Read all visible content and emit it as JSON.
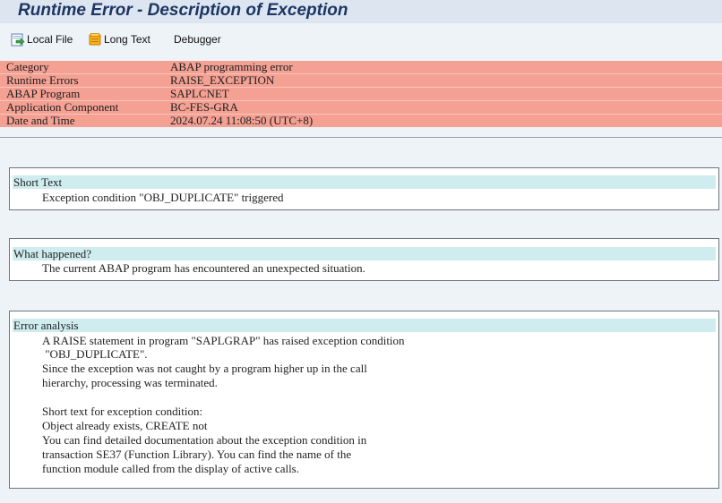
{
  "window": {
    "title": "Runtime Error - Description of Exception"
  },
  "toolbar": {
    "local_file": "Local File",
    "long_text": "Long Text",
    "debugger": "Debugger"
  },
  "header": {
    "rows": [
      {
        "label": "Category",
        "value": "ABAP programming error"
      },
      {
        "label": "Runtime Errors",
        "value": "RAISE_EXCEPTION"
      },
      {
        "label": "ABAP Program",
        "value": "SAPLCNET"
      },
      {
        "label": "Application Component",
        "value": "BC-FES-GRA"
      },
      {
        "label": "Date and Time",
        "value": "2024.07.24 11:08:50 (UTC+8)"
      }
    ]
  },
  "short_text": {
    "title": "Short Text",
    "text": "Exception condition \"OBJ_DUPLICATE\" triggered"
  },
  "what_happened": {
    "title": "What happened?",
    "text": "The current ABAP program has encountered an unexpected situation."
  },
  "error_analysis": {
    "title": "Error analysis",
    "lines": [
      "A RAISE statement in program \"SAPLGRAP\" has raised exception condition",
      " \"OBJ_DUPLICATE\".",
      "Since the exception was not caught by a program higher up in the call",
      "hierarchy, processing was terminated.",
      "",
      "Short text for exception condition:",
      "Object already exists, CREATE not",
      "You can find detailed documentation about the exception condition in",
      "transaction SE37 (Function Library). You can find the name of the",
      "function module called from the display of active calls."
    ]
  },
  "colors": {
    "header_bg": "#f4a093",
    "section_header_bg": "#cfecef",
    "title_color": "#1d3563"
  }
}
